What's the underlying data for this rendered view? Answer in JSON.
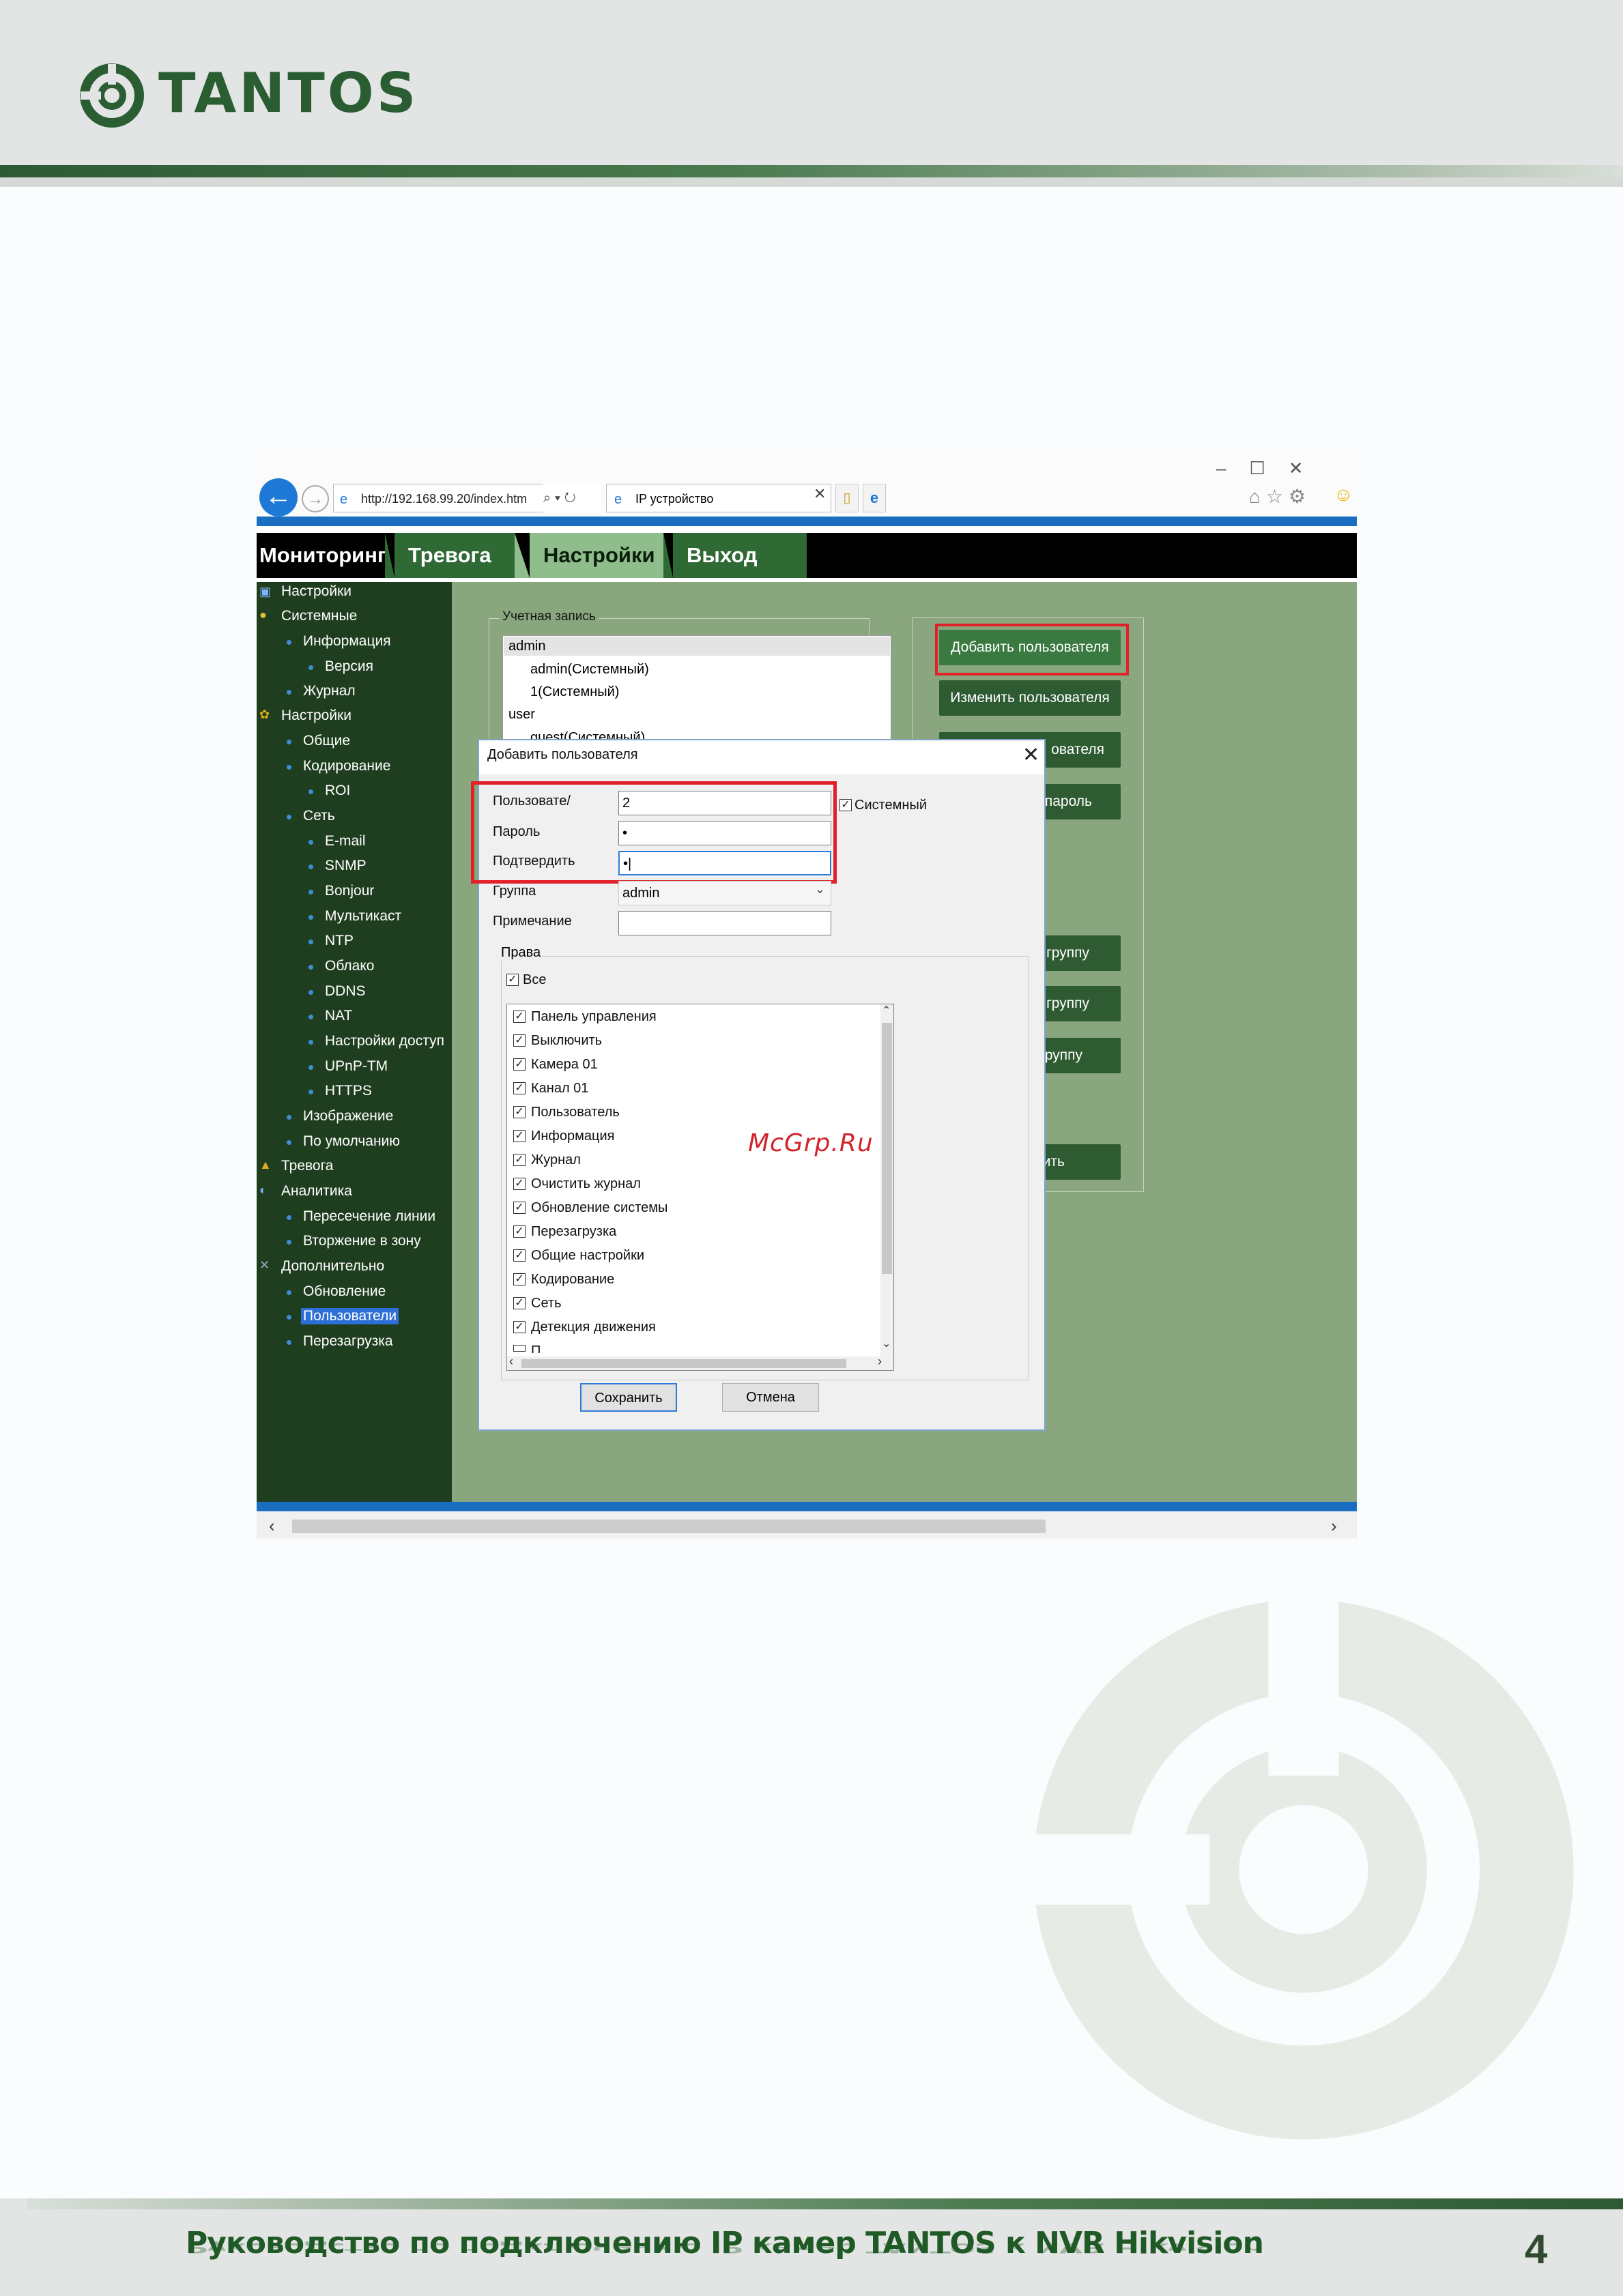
{
  "page": {
    "logo_text": "TANTOS",
    "footer_title": "Руководство по подключению IP камер TANTOS к NVR Hikvision",
    "page_number": "4",
    "watermark": "McGrp.Ru"
  },
  "browser": {
    "address": "http://192.168.99.20/index.htm",
    "address_tools": "⌕ ▾ ↻",
    "tab_title": "IP устройство",
    "window_controls": "–☐✕",
    "toolbar_icons": "⌂☆⚙",
    "smiley": "☺"
  },
  "nav": {
    "tabs": [
      "Мониторинг",
      "Тревога",
      "Настройки",
      "Выход"
    ]
  },
  "sidebar": {
    "items": [
      "Настройки",
      "Системные",
      "Информация",
      "Версия",
      "Журнал",
      "Настройки",
      "Общие",
      "Кодирование",
      "ROI",
      "Сеть",
      "E-mail",
      "SNMP",
      "Bonjour",
      "Мультикаст",
      "NTP",
      "Облако",
      "DDNS",
      "NAT",
      "Настройки доступ",
      "UPnP-TM",
      "HTTPS",
      "Изображение",
      "По умолчанию",
      "Тревога",
      "Аналитика",
      "Пересечение линии",
      "Вторжение в зону",
      "Дополнительно",
      "Обновление",
      "Пользователи",
      "Перезагрузка"
    ]
  },
  "accounts": {
    "title": "Учетная запись",
    "rows": [
      "admin",
      "admin(Системный)",
      "1(Системный)",
      "user",
      "guest(Системный)"
    ]
  },
  "actions": {
    "add_user": "Добавить пользователя",
    "edit_user": "Изменить пользователя",
    "delete_user": "ователя",
    "change_password": "пароль",
    "add_group": "группу",
    "edit_group": "группу",
    "delete_group": "руппу",
    "bottom": "нить"
  },
  "dialog": {
    "title": "Добавить пользователя",
    "close": "✕",
    "user_label": "Пользовате/",
    "user_value": "2",
    "password_label": "Пароль",
    "password_value": "•",
    "confirm_label": "Подтвердить",
    "confirm_value": "•|",
    "group_label": "Группа",
    "group_value": "admin",
    "note_label": "Примечание",
    "note_value": "",
    "system_label": "Системный",
    "system_checked": true,
    "rights_title": "Права",
    "all_label": "Все",
    "rights": [
      "Панель управления",
      "Выключить",
      "Камера 01",
      "Канал 01",
      "Пользователь",
      "Информация",
      "Журнал",
      "Очистить журнал",
      "Обновление системы",
      "Перезагрузка",
      "Общие настройки",
      "Кодирование",
      "Сеть",
      "Детекция движения",
      "П"
    ],
    "save": "Сохранить",
    "cancel": "Отмена"
  }
}
